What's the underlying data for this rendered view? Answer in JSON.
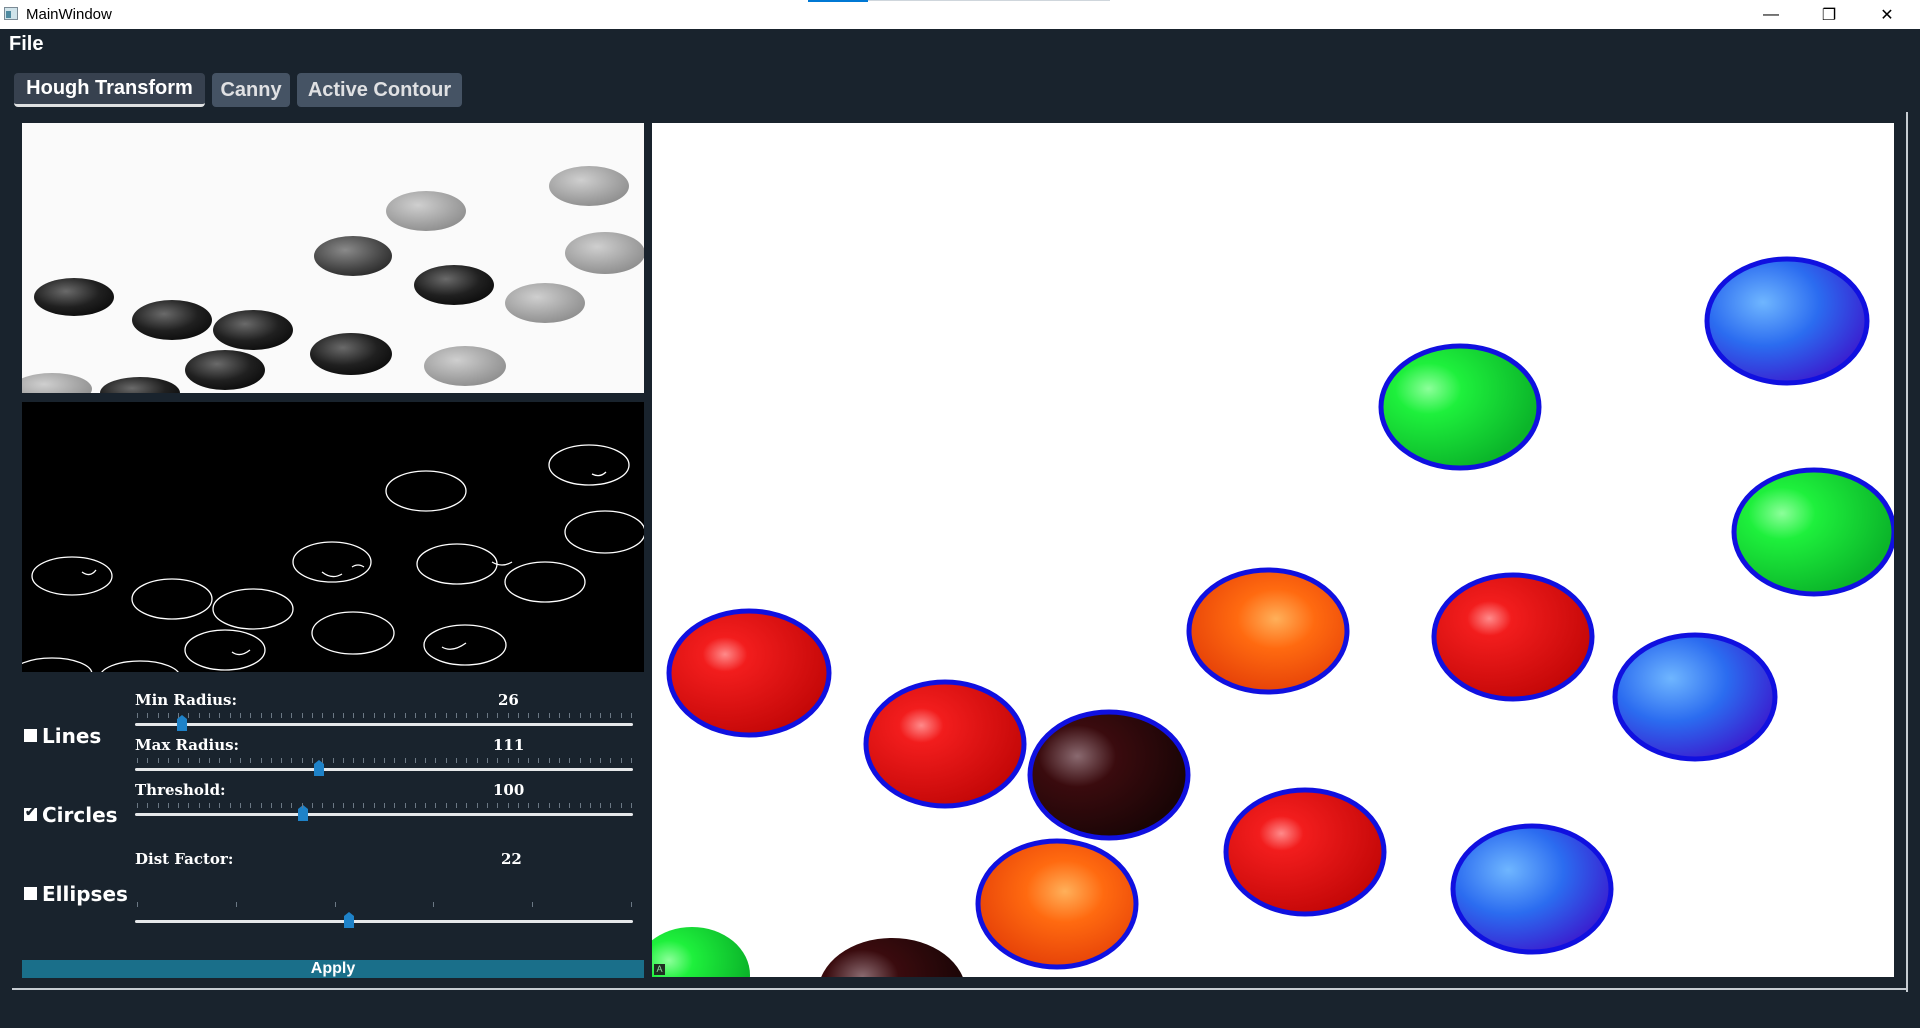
{
  "window": {
    "title": "MainWindow",
    "icon": "app-window-icon"
  },
  "window_controls": {
    "minimize": "—",
    "restore": "❐",
    "close": "✕"
  },
  "menu": {
    "file": "File"
  },
  "tabs": [
    {
      "label": "Hough Transform",
      "active": true
    },
    {
      "label": "Canny",
      "active": false
    },
    {
      "label": "Active Contour",
      "active": false
    }
  ],
  "options": {
    "lines": {
      "label": "Lines",
      "checked": false
    },
    "circles": {
      "label": "Circles",
      "checked": true
    },
    "ellipses": {
      "label": "Ellipses",
      "checked": false
    }
  },
  "sliders": {
    "min_radius": {
      "label": "Min Radius:",
      "value": "26"
    },
    "max_radius": {
      "label": "Max Radius:",
      "value": "111"
    },
    "threshold": {
      "label": "Threshold:",
      "value": "100"
    },
    "dist_factor": {
      "label": "Dist Factor:",
      "value": "22"
    }
  },
  "apply_label": "Apply",
  "colors": {
    "accent": "#1a6f8a",
    "background": "#19232d",
    "tab": "#455364",
    "handle": "#1e82c8",
    "circle_outline": "#1010e0"
  }
}
